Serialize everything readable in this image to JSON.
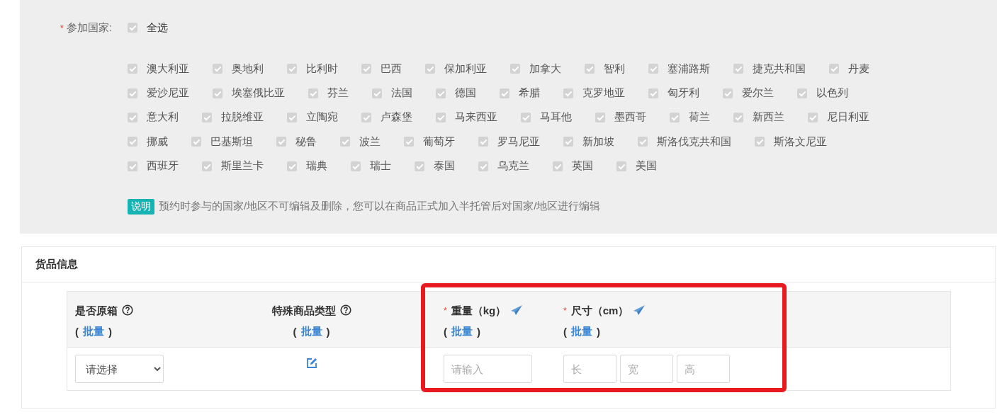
{
  "countries_field": {
    "required_mark": "*",
    "label": "参加国家:",
    "select_all": {
      "label": "全选",
      "checked": true,
      "disabled": true
    },
    "countries": [
      {
        "label": "澳大利亚",
        "checked": true,
        "disabled": true
      },
      {
        "label": "奥地利",
        "checked": true,
        "disabled": true
      },
      {
        "label": "比利时",
        "checked": true,
        "disabled": true
      },
      {
        "label": "巴西",
        "checked": true,
        "disabled": true
      },
      {
        "label": "保加利亚",
        "checked": true,
        "disabled": true
      },
      {
        "label": "加拿大",
        "checked": true,
        "disabled": true
      },
      {
        "label": "智利",
        "checked": true,
        "disabled": true
      },
      {
        "label": "塞浦路斯",
        "checked": true,
        "disabled": true
      },
      {
        "label": "捷克共和国",
        "checked": true,
        "disabled": true
      },
      {
        "label": "丹麦",
        "checked": true,
        "disabled": true
      },
      {
        "label": "爱沙尼亚",
        "checked": true,
        "disabled": true
      },
      {
        "label": "埃塞俄比亚",
        "checked": true,
        "disabled": true
      },
      {
        "label": "芬兰",
        "checked": true,
        "disabled": true
      },
      {
        "label": "法国",
        "checked": true,
        "disabled": true
      },
      {
        "label": "德国",
        "checked": true,
        "disabled": true
      },
      {
        "label": "希腊",
        "checked": true,
        "disabled": true
      },
      {
        "label": "克罗地亚",
        "checked": true,
        "disabled": true
      },
      {
        "label": "匈牙利",
        "checked": true,
        "disabled": true
      },
      {
        "label": "爱尔兰",
        "checked": true,
        "disabled": true
      },
      {
        "label": "以色列",
        "checked": true,
        "disabled": true
      },
      {
        "label": "意大利",
        "checked": true,
        "disabled": true
      },
      {
        "label": "拉脱维亚",
        "checked": true,
        "disabled": true
      },
      {
        "label": "立陶宛",
        "checked": true,
        "disabled": true
      },
      {
        "label": "卢森堡",
        "checked": true,
        "disabled": true
      },
      {
        "label": "马来西亚",
        "checked": true,
        "disabled": true
      },
      {
        "label": "马耳他",
        "checked": true,
        "disabled": true
      },
      {
        "label": "墨西哥",
        "checked": true,
        "disabled": true
      },
      {
        "label": "荷兰",
        "checked": true,
        "disabled": true
      },
      {
        "label": "新西兰",
        "checked": true,
        "disabled": true
      },
      {
        "label": "尼日利亚",
        "checked": true,
        "disabled": true
      },
      {
        "label": "挪威",
        "checked": true,
        "disabled": true
      },
      {
        "label": "巴基斯坦",
        "checked": true,
        "disabled": true
      },
      {
        "label": "秘鲁",
        "checked": true,
        "disabled": true
      },
      {
        "label": "波兰",
        "checked": true,
        "disabled": true
      },
      {
        "label": "葡萄牙",
        "checked": true,
        "disabled": true
      },
      {
        "label": "罗马尼亚",
        "checked": true,
        "disabled": true
      },
      {
        "label": "新加坡",
        "checked": true,
        "disabled": true
      },
      {
        "label": "斯洛伐克共和国",
        "checked": true,
        "disabled": true
      },
      {
        "label": "斯洛文尼亚",
        "checked": true,
        "disabled": true
      },
      {
        "label": "西班牙",
        "checked": true,
        "disabled": true
      },
      {
        "label": "斯里兰卡",
        "checked": true,
        "disabled": true
      },
      {
        "label": "瑞典",
        "checked": true,
        "disabled": true
      },
      {
        "label": "瑞士",
        "checked": true,
        "disabled": true
      },
      {
        "label": "泰国",
        "checked": true,
        "disabled": true
      },
      {
        "label": "乌克兰",
        "checked": true,
        "disabled": true
      },
      {
        "label": "英国",
        "checked": true,
        "disabled": true
      },
      {
        "label": "美国",
        "checked": true,
        "disabled": true
      }
    ],
    "note": {
      "badge": "说明",
      "text": "预约时参与的国家/地区不可编辑及删除，您可以在商品正式加入半托管后对国家/地区进行编辑"
    }
  },
  "goods_info": {
    "title": "货品信息",
    "columns": [
      {
        "label": "是否原箱",
        "kind": "help",
        "batch_open": "(",
        "batch_link": "批量",
        "batch_close": ")"
      },
      {
        "label": "特殊商品类型",
        "kind": "help",
        "batch_open": "(",
        "batch_link": "批量",
        "batch_close": ")"
      },
      {
        "required_mark": "*",
        "label": "重量（kg）",
        "kind": "fill",
        "batch_open": "(",
        "batch_link": "批量",
        "batch_close": ")"
      },
      {
        "required_mark": "*",
        "label": "尺寸（cm）",
        "kind": "fill",
        "batch_open": "(",
        "batch_link": "批量",
        "batch_close": ")"
      }
    ],
    "row": [
      {
        "kind": "select",
        "placeholder": "请选择"
      },
      {
        "kind": "edit"
      },
      {
        "kind": "inputs",
        "placeholders": [
          "请输入"
        ]
      },
      {
        "kind": "inputs",
        "placeholders": [
          "长",
          "宽",
          "高"
        ]
      }
    ]
  }
}
